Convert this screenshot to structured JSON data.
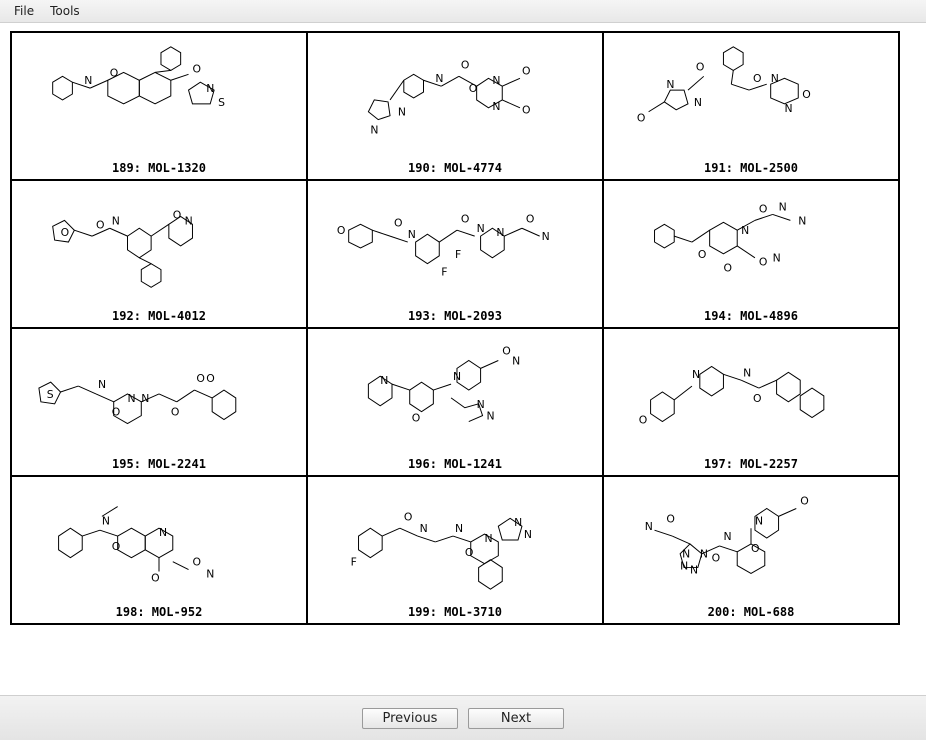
{
  "menu": {
    "file": "File",
    "tools": "Tools"
  },
  "molecules": [
    {
      "index": 189,
      "id": "MOL-1320",
      "caption": "189: MOL-1320"
    },
    {
      "index": 190,
      "id": "MOL-4774",
      "caption": "190: MOL-4774"
    },
    {
      "index": 191,
      "id": "MOL-2500",
      "caption": "191: MOL-2500"
    },
    {
      "index": 192,
      "id": "MOL-4012",
      "caption": "192: MOL-4012"
    },
    {
      "index": 193,
      "id": "MOL-2093",
      "caption": "193: MOL-2093"
    },
    {
      "index": 194,
      "id": "MOL-4896",
      "caption": "194: MOL-4896"
    },
    {
      "index": 195,
      "id": "MOL-2241",
      "caption": "195: MOL-2241"
    },
    {
      "index": 196,
      "id": "MOL-1241",
      "caption": "196: MOL-1241"
    },
    {
      "index": 197,
      "id": "MOL-2257",
      "caption": "197: MOL-2257"
    },
    {
      "index": 198,
      "id": "MOL-952",
      "caption": "198: MOL-952"
    },
    {
      "index": 199,
      "id": "MOL-3710",
      "caption": "199: MOL-3710"
    },
    {
      "index": 200,
      "id": "MOL-688",
      "caption": "200: MOL-688"
    }
  ],
  "footer": {
    "previous": "Previous",
    "next": "Next"
  }
}
